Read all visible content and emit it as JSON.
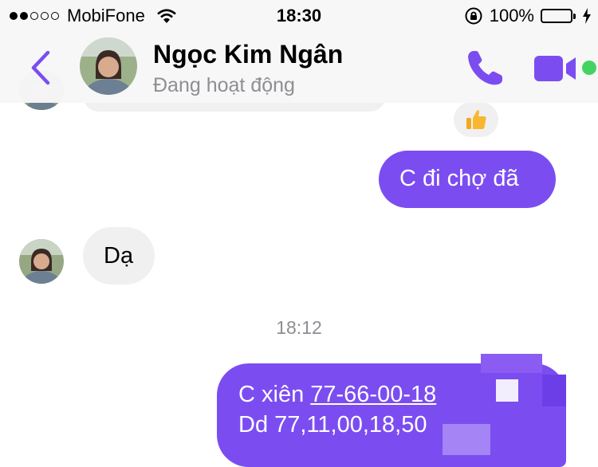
{
  "status_bar": {
    "carrier": "MobiFone",
    "time": "18:30",
    "battery_percent": "100%",
    "signal_bars_filled": 2,
    "battery_level": 1.0
  },
  "header": {
    "contact_name": "Ngọc Kim Ngân",
    "contact_status": "Đang hoạt động",
    "icons": [
      "back-icon",
      "avatar",
      "phone-icon",
      "video-icon",
      "online-dot"
    ]
  },
  "messages": {
    "like_icon": "thumbs-up-icon",
    "out_1": "C đi chợ đã",
    "in_1": "Dạ",
    "timestamp": "18:12",
    "out_2_prefix": "C xiên ",
    "out_2_link": "77-66-00-18",
    "out_2_line2": "Dd 77,11,00,18,50"
  },
  "colors": {
    "accent": "#7b4df0",
    "incoming_bubble": "#f1f0f0",
    "online": "#44d362",
    "battery": "#4cd964",
    "muted": "#8e8e93"
  }
}
